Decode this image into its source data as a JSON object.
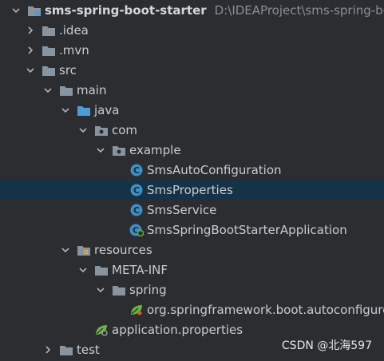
{
  "tree": {
    "rows": [
      {
        "label": "sms-spring-boot-starter",
        "path": "D:\\IDEAProject\\sms-spring-boot",
        "icon": "module-folder-icon"
      },
      {
        "label": ".idea",
        "icon": "folder-icon"
      },
      {
        "label": ".mvn",
        "icon": "folder-icon"
      },
      {
        "label": "src",
        "icon": "folder-icon"
      },
      {
        "label": "main",
        "icon": "folder-icon"
      },
      {
        "label": "java",
        "icon": "source-folder-icon"
      },
      {
        "label": "com",
        "icon": "package-icon"
      },
      {
        "label": "example",
        "icon": "package-icon"
      },
      {
        "label": "SmsAutoConfiguration",
        "icon": "class-icon"
      },
      {
        "label": "SmsProperties",
        "icon": "class-icon"
      },
      {
        "label": "SmsService",
        "icon": "class-icon"
      },
      {
        "label": "SmsSpringBootStarterApplication",
        "icon": "spring-boot-app-icon"
      },
      {
        "label": "resources",
        "icon": "resources-folder-icon"
      },
      {
        "label": "META-INF",
        "icon": "folder-icon"
      },
      {
        "label": "spring",
        "icon": "folder-icon"
      },
      {
        "label": "org.springframework.boot.autoconfigure.AutoConfiguration.imports",
        "icon": "spring-file-icon"
      },
      {
        "label": "application.properties",
        "icon": "spring-properties-icon"
      },
      {
        "label": "test",
        "icon": "folder-icon"
      }
    ]
  },
  "watermark": "CSDN @北海597",
  "colors": {
    "background": "#2b2d30",
    "selection": "#163247",
    "text": "#c9ccd2",
    "folder": "#88949f",
    "source_folder": "#4a9ed8",
    "class_icon": "#3d8fc7",
    "spring_green": "#6db33f"
  }
}
